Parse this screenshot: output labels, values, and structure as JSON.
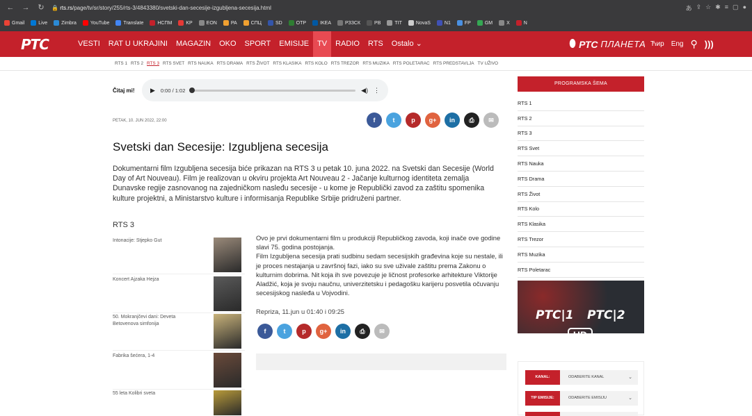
{
  "browser": {
    "url_host": "rts.rs",
    "url_path": "/page/tv/sr/story/255/rts-3/4843380/svetski-dan-secesije-izgubljena-secesija.html",
    "bookmarks": [
      {
        "label": "Gmail",
        "color": "#ea4335"
      },
      {
        "label": "Live",
        "color": "#0078d4"
      },
      {
        "label": "Zimbra",
        "color": "#2b8ad6"
      },
      {
        "label": "YouTube",
        "color": "#ff0000"
      },
      {
        "label": "Translate",
        "color": "#4285f4"
      },
      {
        "label": "НСПМ",
        "color": "#c4212b"
      },
      {
        "label": "KP",
        "color": "#e53935"
      },
      {
        "label": "EON",
        "color": "#888888"
      },
      {
        "label": "PA",
        "color": "#f0a030"
      },
      {
        "label": "СПЦ",
        "color": "#f0a030"
      },
      {
        "label": "SD",
        "color": "#3355aa"
      },
      {
        "label": "OTP",
        "color": "#2e7d32"
      },
      {
        "label": "IKEA",
        "color": "#0058a3"
      },
      {
        "label": "РЗЗСК",
        "color": "#777777"
      },
      {
        "label": "PB",
        "color": "#555555"
      },
      {
        "label": "TIT",
        "color": "#999999"
      },
      {
        "label": "NovaS",
        "color": "#cccccc"
      },
      {
        "label": "N1",
        "color": "#3f51b5"
      },
      {
        "label": "FP",
        "color": "#4a90e2"
      },
      {
        "label": "GM",
        "color": "#34a853"
      },
      {
        "label": "X",
        "color": "#888888"
      },
      {
        "label": "N",
        "color": "#c4212b"
      }
    ]
  },
  "header": {
    "logo": "РТС",
    "nav": [
      "VESTI",
      "RAT U UKRAJINI",
      "MAGAZIN",
      "OKO",
      "SPORT",
      "EMISIJE",
      "TV",
      "RADIO",
      "RTS",
      "Ostalo"
    ],
    "active_nav": "TV",
    "planeta_logo": "РТС",
    "planeta_name": "ПЛАНЕТА",
    "lang_cyr": "Ћир",
    "lang_eng": "Eng"
  },
  "subnav": [
    "RTS 1",
    "RTS 2",
    "RTS 3",
    "RTS SVET",
    "RTS NAUKA",
    "RTS DRAMA",
    "RTS ŽIVOT",
    "RTS KLASIKA",
    "RTS KOLO",
    "RTS TREZOR",
    "RTS MUZIKA",
    "RTS POLETARAC",
    "RTS PREDSTAVLJA",
    "TV UŽIVO"
  ],
  "subnav_active": "RTS 3",
  "audio": {
    "label": "Čitaj mi!",
    "time": "0:00 / 1:02"
  },
  "article": {
    "date": "PETAK, 10. JUN 2022, 22:00",
    "title": "Svetski dan Secesije: Izgubljena secesija",
    "lead": "Dokumentarni film Izgubljena secesija biće prikazan na RTS 3 u petak 10. juna 2022. na Svetski dan Secesije (World Day of Art Nouveau). Film je realizovan u okviru projekta Art Nouveau 2 - Jačanje kulturnog identiteta zemalja Dunavske regije zasnovanog na zajedničkom nasleđu secesije - u kome je Republički zavod za zaštitu spomenika kulture projektni, a Ministarstvo kulture i informisanja Republike Srbije pridruženi partner.",
    "channel": "RTS 3",
    "body": "Ovo je prvi dokumentarni film u produkciji Republičkog zavoda, koji inače ove godine slavi 75. godina postojanja.\nFilm Izgubljena secesija prati sudbinu sedam secesijskih građevina koje su nestale, ili je proces nestajanja u završnoj fazi, iako su sve uživale zaštitu prema Zakonu o kulturnim dobrima. Nit koja ih sve povezuje je ličnost profesorke arhitekture Viktorije Aladžić, koja je svoju naučnu, univerzitetsku i pedagošku karijeru posvetila očuvanju secesijskog nasleđa u Vojvodini.",
    "rerun": "Repriza,  11.jun u 01:40 i 09:25"
  },
  "share": [
    {
      "name": "facebook",
      "glyph": "f",
      "color": "#3b5998"
    },
    {
      "name": "twitter",
      "glyph": "t",
      "color": "#4aa3df"
    },
    {
      "name": "pinterest",
      "glyph": "p",
      "color": "#b52a2a"
    },
    {
      "name": "google-plus",
      "glyph": "g+",
      "color": "#e0633f"
    },
    {
      "name": "linkedin",
      "glyph": "in",
      "color": "#1d6fa5"
    },
    {
      "name": "print",
      "glyph": "⎙",
      "color": "#222222"
    },
    {
      "name": "email",
      "glyph": "✉",
      "color": "#bbbbbb"
    }
  ],
  "related": [
    {
      "title": "Intonacije: Stjepko Gut"
    },
    {
      "title": "Koncert Ajzaka Hejza"
    },
    {
      "title": "50. Mokranjčevi dani: Deveta Betovenova simfonija"
    },
    {
      "title": "Fabrika šećera, 1-4"
    },
    {
      "title": "55 leta Kolibri sveta"
    }
  ],
  "sidebar": {
    "schedule_button": "PROGRAMSKA ŠEMA",
    "channels": [
      "RTS 1",
      "RTS 2",
      "RTS 3",
      "RTS Svet",
      "RTS Nauka",
      "RTS Drama",
      "RTS Život",
      "RTS Kolo",
      "RTS Klasika",
      "RTS Trezor",
      "RTS Muzika",
      "RTS Poletarac"
    ],
    "banner_logo_1": "РТС|1",
    "banner_logo_2": "РТС|2",
    "banner_hd": "HD",
    "filters": [
      {
        "label": "KANAL:",
        "value": "ODABERITE KANAL"
      },
      {
        "label": "TIP EMISIJE:",
        "value": "ODABERITE EMISIJU"
      }
    ]
  }
}
